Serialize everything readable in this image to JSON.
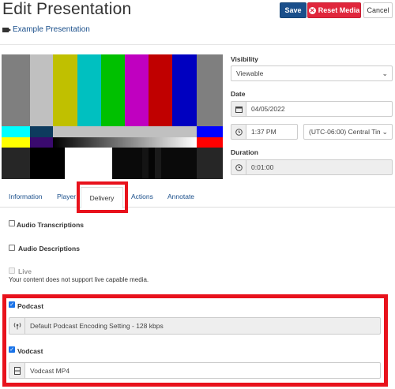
{
  "header": {
    "title": "Edit Presentation",
    "save_label": "Save",
    "reset_label": "Reset Media",
    "cancel_label": "Cancel",
    "presentation_link": "Example Presentation"
  },
  "tabs": [
    {
      "label": "Information"
    },
    {
      "label": "Player"
    },
    {
      "label": "Delivery"
    },
    {
      "label": "Actions"
    },
    {
      "label": "Annotate"
    }
  ],
  "sidebar": {
    "visibility_label": "Visibility",
    "visibility_value": "Viewable",
    "date_label": "Date",
    "date_value": "04/05/2022",
    "time_value": "1:37 PM",
    "timezone_value": "(UTC-06:00) Central Tim",
    "duration_label": "Duration",
    "duration_value": "0:01:00"
  },
  "delivery": {
    "audio_transcriptions": "Audio Transcriptions",
    "audio_descriptions": "Audio Descriptions",
    "live_label": "Live",
    "live_note": "Your content does not support live capable media.",
    "podcast_label": "Podcast",
    "podcast_value": "Default Podcast Encoding Setting - 128 kbps",
    "vodcast_label": "Vodcast",
    "vodcast_value": "Vodcast MP4"
  },
  "colors": {
    "accent": "#1a4f8b",
    "danger": "#e0263c",
    "highlight": "#e8121c"
  }
}
